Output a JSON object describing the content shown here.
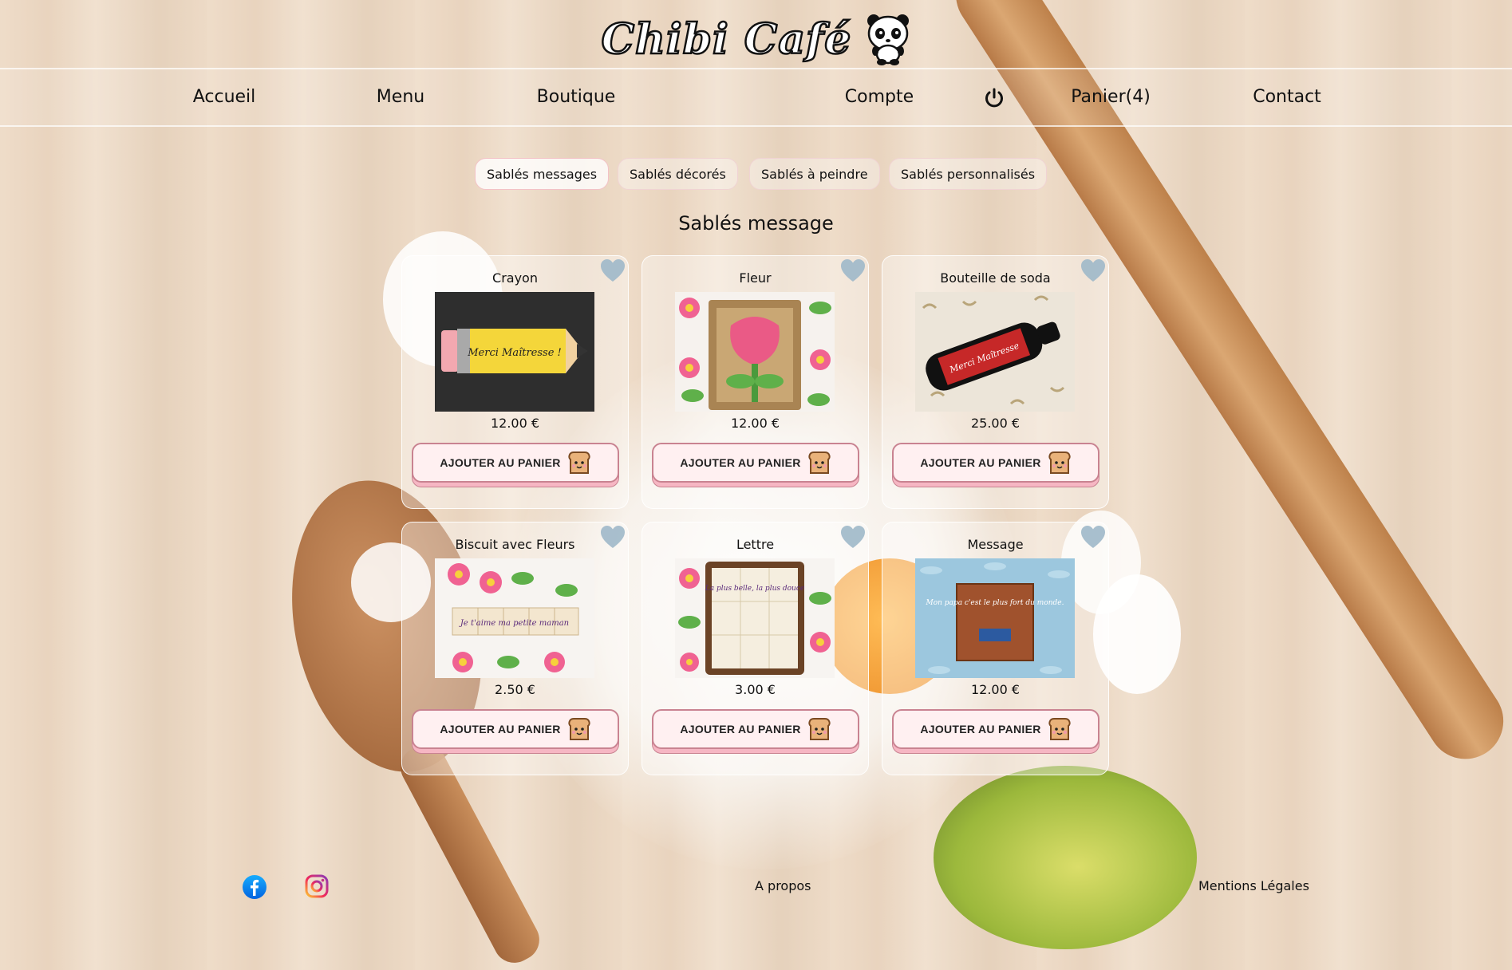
{
  "header": {
    "logo_text": "Chibi Café"
  },
  "nav": {
    "items": [
      {
        "label": "Accueil"
      },
      {
        "label": "Menu"
      },
      {
        "label": "Boutique"
      },
      {
        "label": "Compte"
      },
      {
        "label": "Panier(4)"
      },
      {
        "label": "Contact"
      }
    ],
    "power_icon": "power-icon"
  },
  "filters": [
    {
      "label": "Sablés messages",
      "active": true
    },
    {
      "label": "Sablés décorés",
      "active": false
    },
    {
      "label": "Sablés à peindre",
      "active": false
    },
    {
      "label": "Sablés personnalisés",
      "active": false
    }
  ],
  "section_title": "Sablés message",
  "products": [
    {
      "name": "Crayon",
      "price": "12.00 €",
      "cta": "AJOUTER AU PANIER"
    },
    {
      "name": "Fleur",
      "price": "12.00 €",
      "cta": "AJOUTER AU PANIER"
    },
    {
      "name": "Bouteille de soda",
      "price": "25.00 €",
      "cta": "AJOUTER AU PANIER"
    },
    {
      "name": "Biscuit avec Fleurs",
      "price": "2.50 €",
      "cta": "AJOUTER AU PANIER"
    },
    {
      "name": "Lettre",
      "price": "3.00 €",
      "cta": "AJOUTER AU PANIER"
    },
    {
      "name": "Message",
      "price": "12.00 €",
      "cta": "AJOUTER AU PANIER"
    }
  ],
  "product_images_text": {
    "crayon": "Merci Maîtresse !",
    "bouteille": "Merci Maîtresse",
    "biscuit": "Je t'aime ma petite maman",
    "lettre": "La plus belle, la plus douce",
    "message": "Mon papa c'est le plus fort du monde."
  },
  "footer": {
    "facebook_icon": "facebook-icon",
    "instagram_icon": "instagram-icon",
    "about": "A propos",
    "legal": "Mentions Légales"
  },
  "colors": {
    "accent_pink": "#f6b6c3",
    "button_border": "#c98391",
    "heart": "#9fb8c9"
  }
}
